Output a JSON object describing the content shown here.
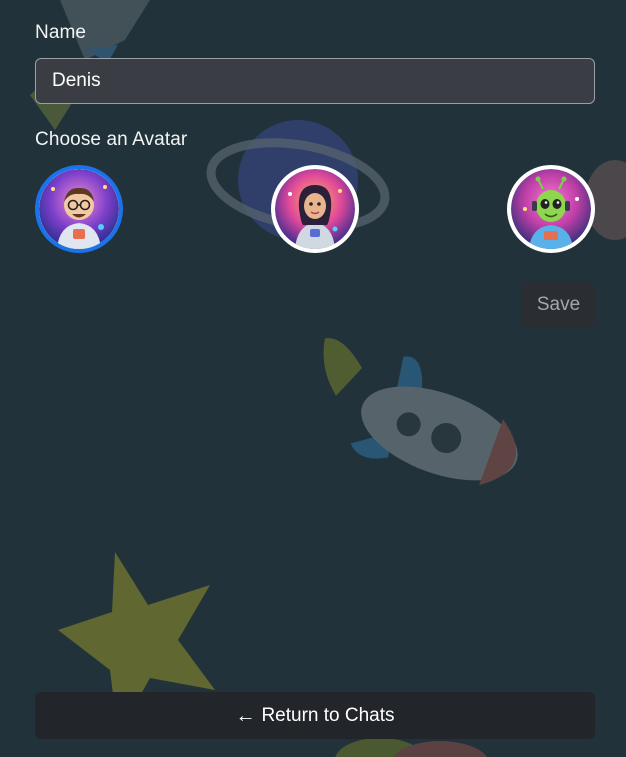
{
  "form": {
    "name_label": "Name",
    "name_value": "Denis",
    "avatar_label": "Choose an Avatar",
    "save_label": "Save",
    "selected_avatar_index": 0
  },
  "avatars": [
    {
      "icon": "astronaut-boy-avatar-icon",
      "selected": true
    },
    {
      "icon": "astronaut-girl-avatar-icon",
      "selected": false
    },
    {
      "icon": "alien-avatar-icon",
      "selected": false
    }
  ],
  "footer": {
    "return_icon": "arrow-left-icon",
    "return_arrow": "←",
    "return_label": "Return to Chats"
  },
  "colors": {
    "background": "#22323a",
    "input_background": "#3b3d45",
    "selected_avatar_border": "#1a73e8",
    "button_background": "#22252a",
    "save_text": "#a3a6ab"
  }
}
